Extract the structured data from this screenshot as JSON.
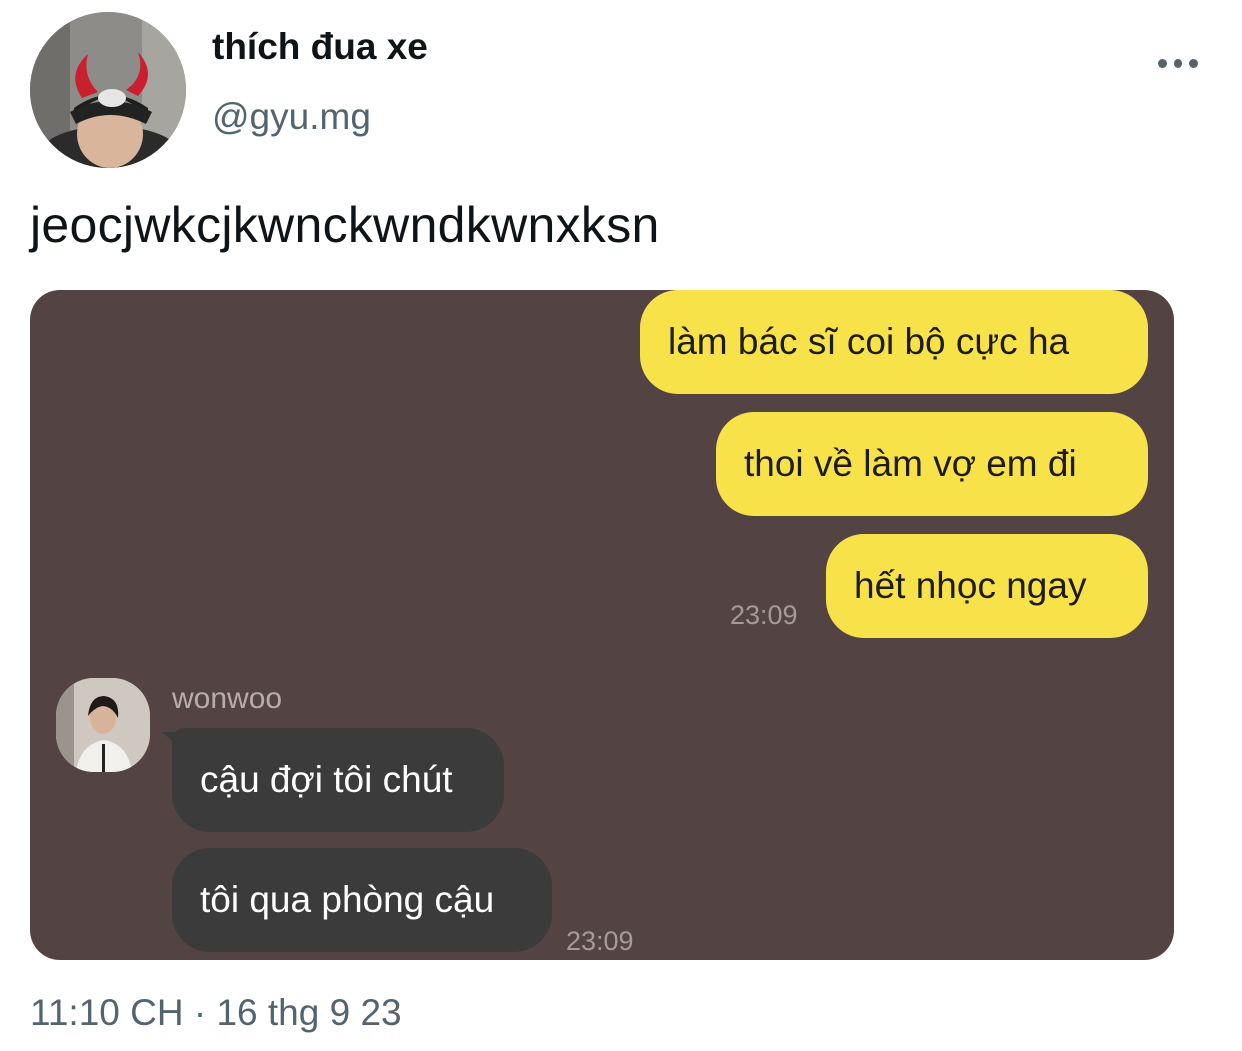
{
  "header": {
    "display_name": "thích đua xe",
    "handle": "@gyu.mg",
    "avatar_icon": "profile-photo-devil-horns",
    "more_icon": "more-options-icon"
  },
  "tweet": {
    "text": "jeocjwkcjkwnckwndkwnxksn"
  },
  "chat": {
    "outgoing": [
      {
        "text": "làm bác sĩ coi bộ cực ha"
      },
      {
        "text": "thoi về làm vợ em đi"
      },
      {
        "text": "hết nhọc ngay"
      }
    ],
    "outgoing_time": "23:09",
    "sender_name": "wonwoo",
    "incoming": [
      {
        "text": "cậu đợi tôi chút"
      },
      {
        "text": "tôi qua phòng cậu"
      }
    ],
    "incoming_time": "23:09",
    "colors": {
      "background": "#534343",
      "outgoing_bubble": "#f8e24a",
      "incoming_bubble": "#3c3b3b"
    }
  },
  "footer": {
    "timestamp": "11:10 CH",
    "separator": "·",
    "date": "16 thg 9 23"
  }
}
